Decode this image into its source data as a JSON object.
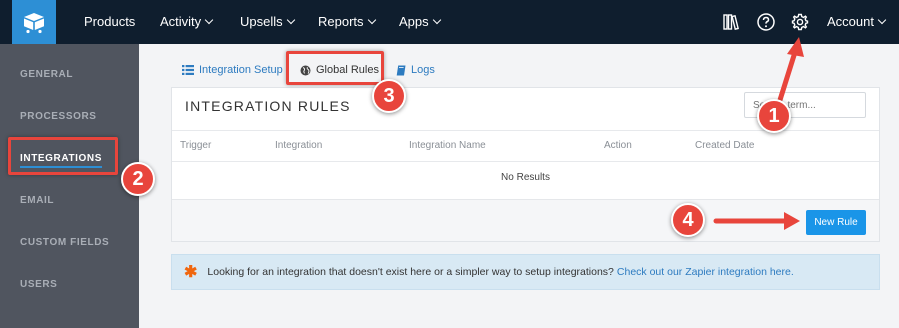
{
  "topnav": {
    "items": [
      {
        "label": "Products",
        "dropdown": false
      },
      {
        "label": "Activity",
        "dropdown": true
      },
      {
        "label": "Upsells",
        "dropdown": true
      },
      {
        "label": "Reports",
        "dropdown": true
      },
      {
        "label": "Apps",
        "dropdown": true
      }
    ],
    "icons": [
      "library-icon",
      "help-icon",
      "gear-icon"
    ],
    "account_label": "Account"
  },
  "sidebar": {
    "items": [
      {
        "label": "GENERAL"
      },
      {
        "label": "PROCESSORS"
      },
      {
        "label": "INTEGRATIONS",
        "active": true
      },
      {
        "label": "EMAIL"
      },
      {
        "label": "CUSTOM FIELDS"
      },
      {
        "label": "USERS"
      }
    ]
  },
  "tabs": [
    {
      "label": "Integration Setup",
      "icon": "list-icon"
    },
    {
      "label": "Global Rules",
      "icon": "globe-icon",
      "active": true
    },
    {
      "label": "Logs",
      "icon": "book-icon"
    }
  ],
  "card": {
    "title": "INTEGRATION RULES",
    "search_placeholder": "Search term...",
    "columns": [
      "Trigger",
      "Integration",
      "Integration Name",
      "Action",
      "Created Date"
    ],
    "empty_text": "No Results",
    "new_button": "New Rule"
  },
  "info": {
    "text": "Looking for an integration that doesn't exist here or a simpler way to setup integrations?",
    "link": "Check out our Zapier integration here."
  },
  "annotations": {
    "badges": [
      "1",
      "2",
      "3",
      "4"
    ],
    "color": "#e8453c"
  },
  "colors": {
    "topbar": "#0f1e2e",
    "brand": "#2d8fd5",
    "sidebar": "#50555f",
    "primary_button": "#1a95e8"
  }
}
